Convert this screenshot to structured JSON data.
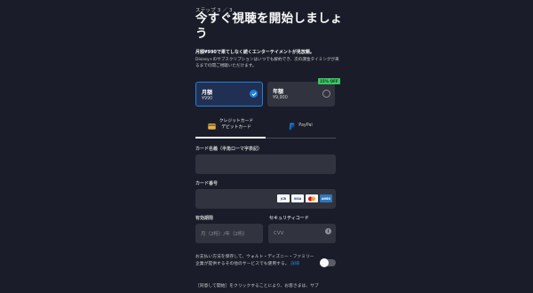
{
  "signup": {
    "step": "ステップ 3 ／ 3",
    "title": "今すぐ視聴を開始しましょう",
    "lead": "月額¥990で果てしなく続くエンターテイメントが見放題。",
    "note": "Disney+のサブスクリプションはいつでも解約でき、次の課金タイミングが来るまでの間ご視聴いただけます。",
    "plans": [
      {
        "name": "月額",
        "price": "¥990",
        "selected": true
      },
      {
        "name": "年額",
        "price": "¥9,900",
        "selected": false,
        "badge": "15% OFF"
      }
    ],
    "tabs": [
      {
        "label": "クレジットカード\nデビットカード",
        "icon": "credit-card-icon"
      },
      {
        "label": "PayPal",
        "icon": "paypal-icon"
      }
    ],
    "fields": {
      "name_label": "カード名義（半角ローマ字表記）",
      "number_label": "カード番号",
      "expiry_label": "有効期限",
      "expiry_placeholder": "月（2桁）/年（2桁）",
      "cvv_label": "セキュリティコード",
      "cvv_placeholder": "CVV"
    },
    "card_brands": [
      "JCB",
      "VISA",
      "MC",
      "AMEX"
    ],
    "save_text": "お支払い方法を保存して、ウォルト・ディズニー・ファミリー企業が提供するその他のサービスでも使用する。",
    "save_link": "詳細",
    "terms": "［同意して開始］をクリックすることにより、お客さまは、サブ"
  },
  "colors": {
    "background": "#1a1d29",
    "accent": "#1f80e0",
    "field": "#31343e",
    "badge": "#3dc467"
  }
}
